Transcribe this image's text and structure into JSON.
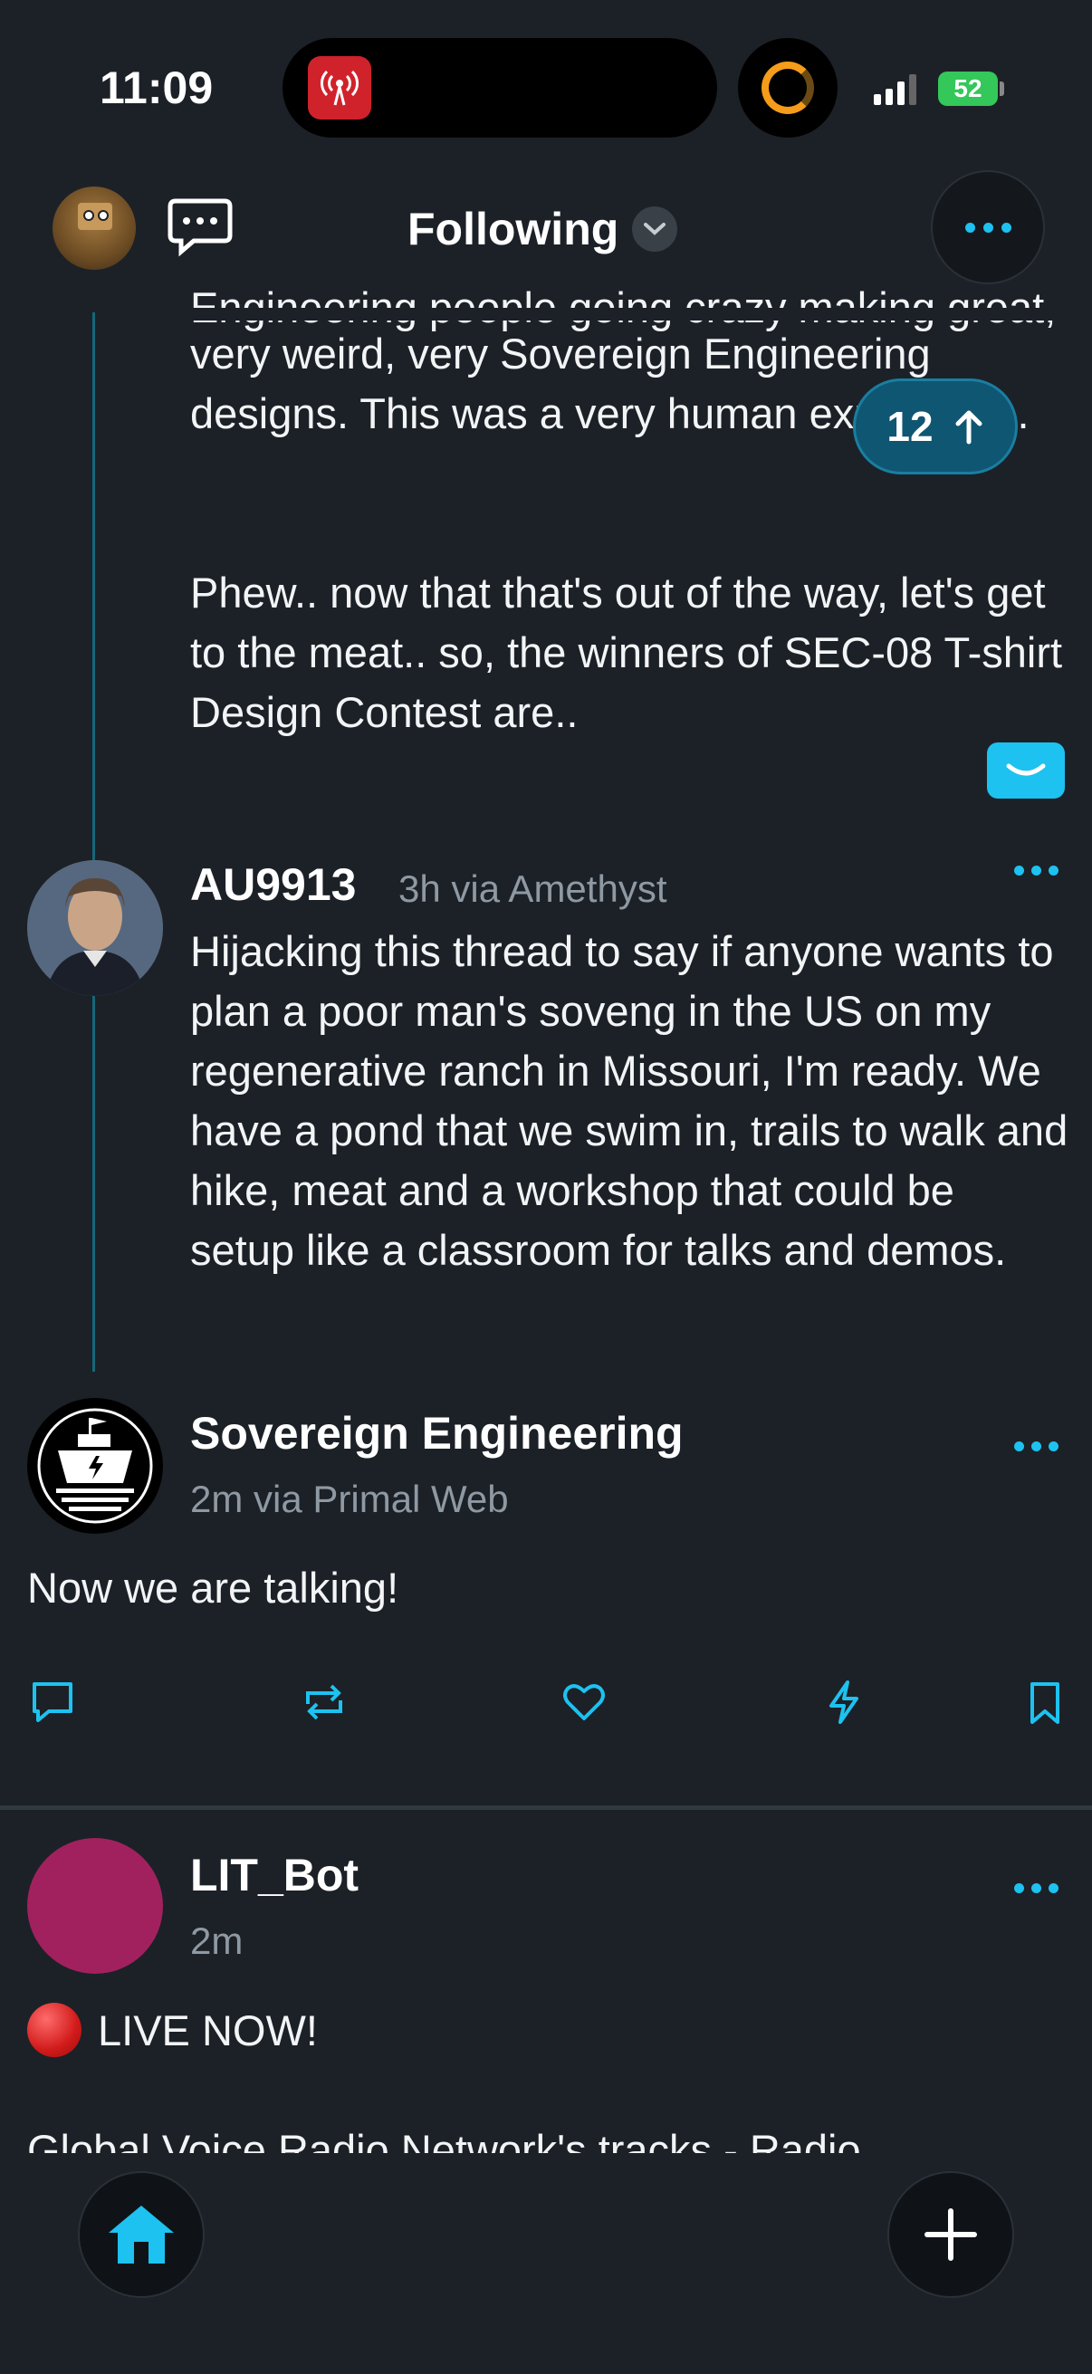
{
  "status_bar": {
    "time": "11:09",
    "battery": "52"
  },
  "header": {
    "title": "Following"
  },
  "feed": {
    "thread_partial_text": "very weird, very Sovereign Engineering designs. This was a very human experience.",
    "thread_text_2": "Phew.. now that that's out of the way, let's get to the meat.. so, the winners of SEC-08 T-shirt Design Contest are..",
    "new_posts_pill": "12",
    "reply": {
      "author": "AU9913",
      "meta": "3h  via Amethyst",
      "text": "Hijacking this thread to say if anyone wants to plan a poor man's soveng in the US on my regenerative ranch in Missouri, I'm ready. We have a pond that we swim in, trails to walk and hike, meat and a workshop that could be setup like a classroom for talks and demos."
    },
    "main_post": {
      "author": "Sovereign Engineering",
      "meta": "2m  via Primal Web",
      "text": "Now we are talking!"
    },
    "next_post": {
      "author": "LIT_Bot",
      "meta": "2m",
      "live_text": "LIVE NOW!",
      "cut_text": "Global Voice Radio Network's tracks - Radio"
    }
  },
  "colors": {
    "background": "#1c2127",
    "accent": "#1dc2f0",
    "muted_text": "#8f99a3"
  }
}
